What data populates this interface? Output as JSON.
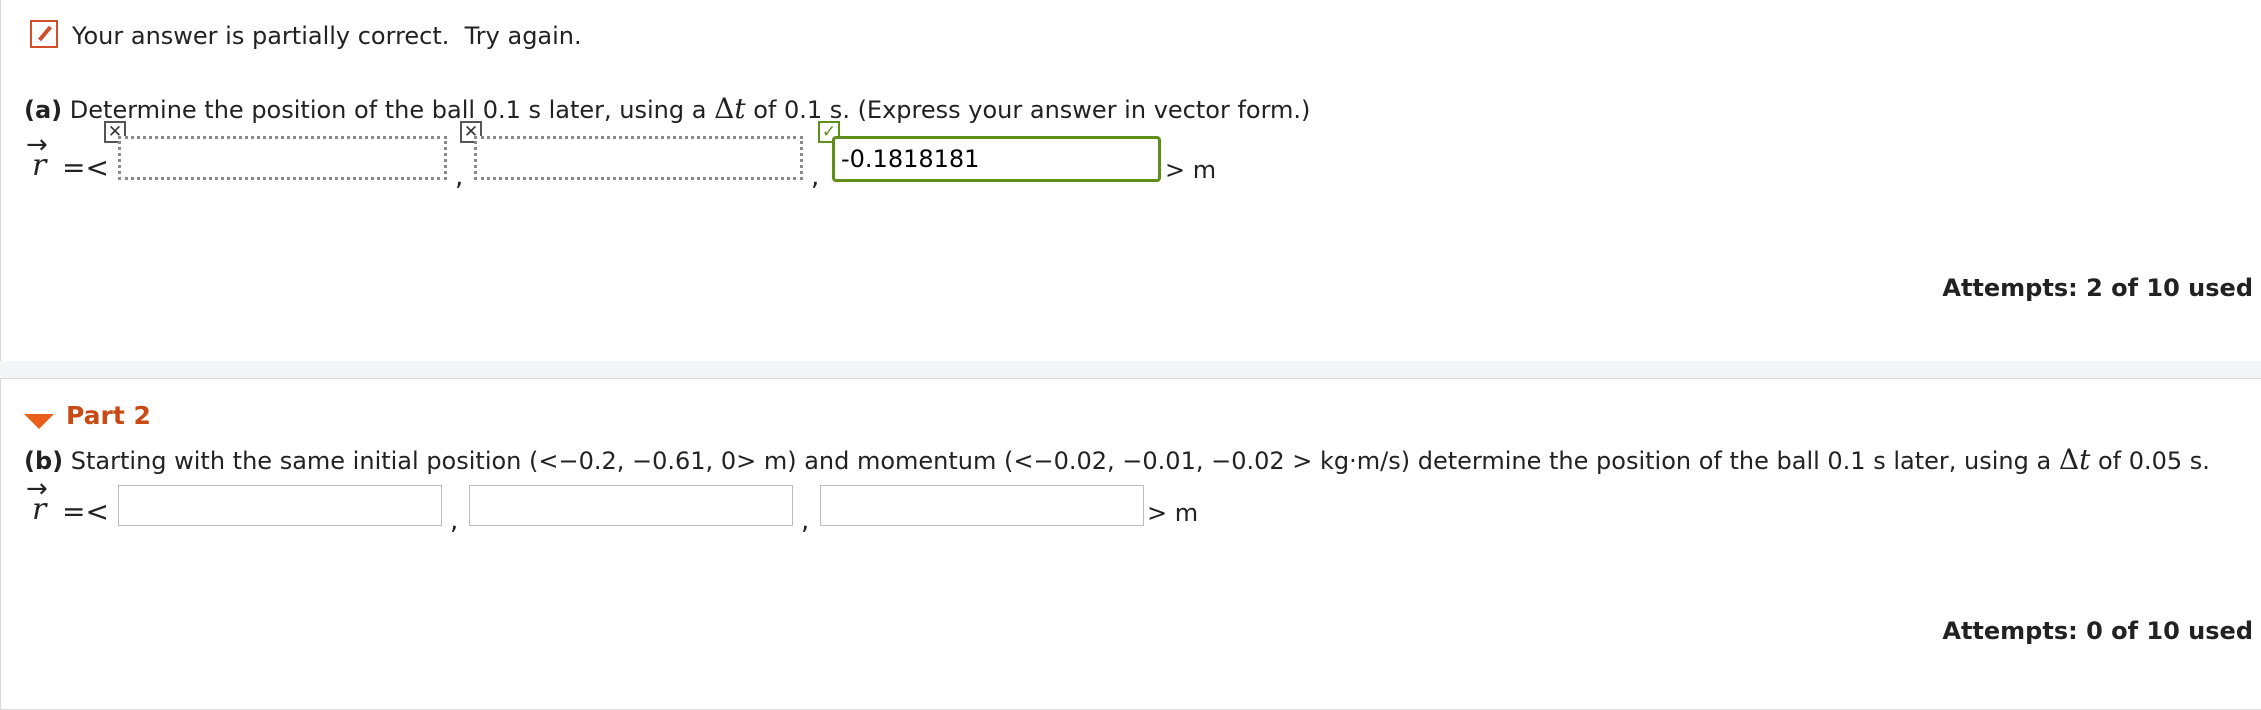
{
  "part1": {
    "status_text": "Your answer is partially correct.  Try again.",
    "question_letter": "(a)",
    "question_before": "Determine the position of the ball 0.1 s later, using a",
    "delta_symbol": "Δ",
    "t_symbol": "t",
    "question_after": "of 0.1 s. (Express your answer in vector form.)",
    "vector_symbol": "r",
    "vector_arrow": "→",
    "eq_open": "=<",
    "comma": ",",
    "unit": "> m",
    "field1_value": "",
    "field2_value": "",
    "field3_value": "-0.1818181",
    "wrong_mark": "✕",
    "ok_mark": "✓",
    "attempts": "Attempts: 2 of 10 used"
  },
  "part2": {
    "title": "Part 2",
    "question_letter": "(b)",
    "question_before": "Starting with the same initial position (<−0.2, −0.61, 0> m) and momentum (<−0.02, −0.01, −0.02 > kg·m/s) determine the position of the ball 0.1 s later, using a",
    "delta_symbol": "Δ",
    "t_symbol": "t",
    "question_after": "of 0.05 s.",
    "vector_symbol": "r",
    "vector_arrow": "→",
    "eq_open": "=<",
    "comma": ",",
    "unit": "> m",
    "field1_value": "",
    "field2_value": "",
    "field3_value": "",
    "attempts": "Attempts: 0 of 10 used"
  },
  "colors": {
    "error": "#d14f2a",
    "correct": "#5f8f1a",
    "part_title": "#c94a14"
  }
}
